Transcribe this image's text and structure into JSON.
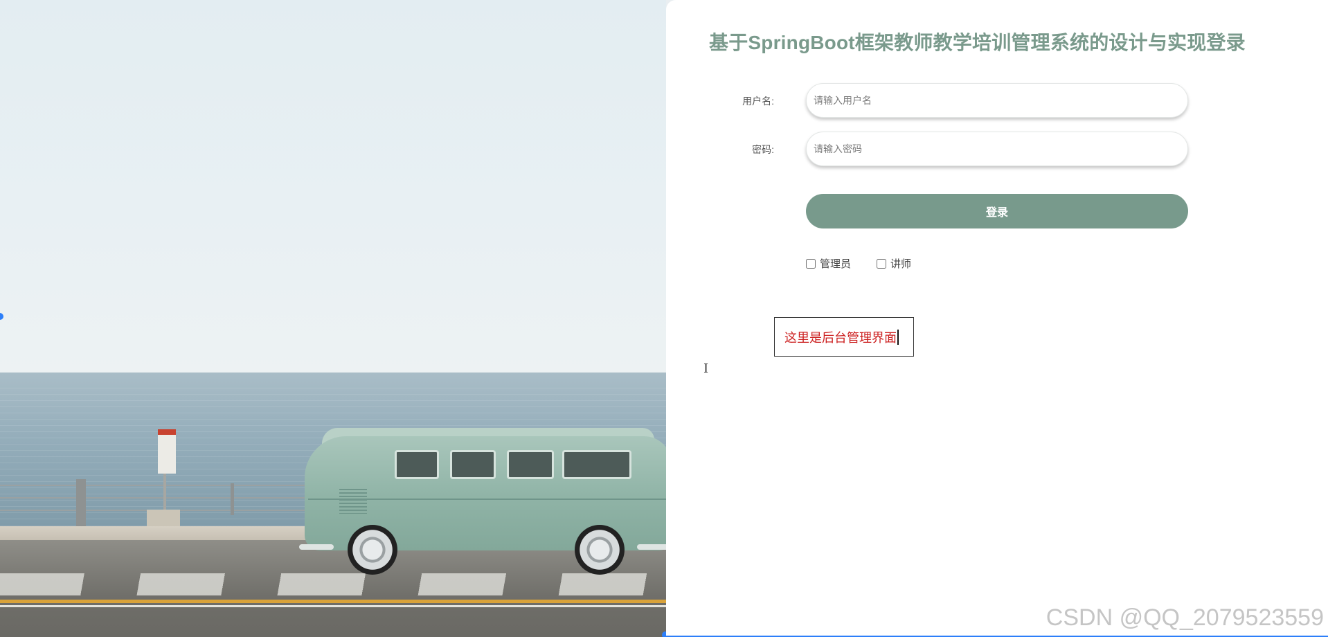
{
  "login": {
    "title": "基于SpringBoot框架教师教学培训管理系统的设计与实现登录",
    "username_label": "用户名:",
    "username_placeholder": "请输入用户名",
    "password_label": "密码:",
    "password_placeholder": "请输入密码",
    "login_button": "登录",
    "roles": [
      {
        "label": "管理员",
        "checked": false
      },
      {
        "label": "讲师",
        "checked": false
      }
    ],
    "note_text": "这里是后台管理界面"
  },
  "watermark": "CSDN @QQ_2079523559",
  "colors": {
    "accent": "#789a8c",
    "title": "#7a9a8c",
    "note": "#cc1f1f",
    "selection": "#2d7ff9"
  },
  "icons": [
    "text-cursor-icon"
  ]
}
